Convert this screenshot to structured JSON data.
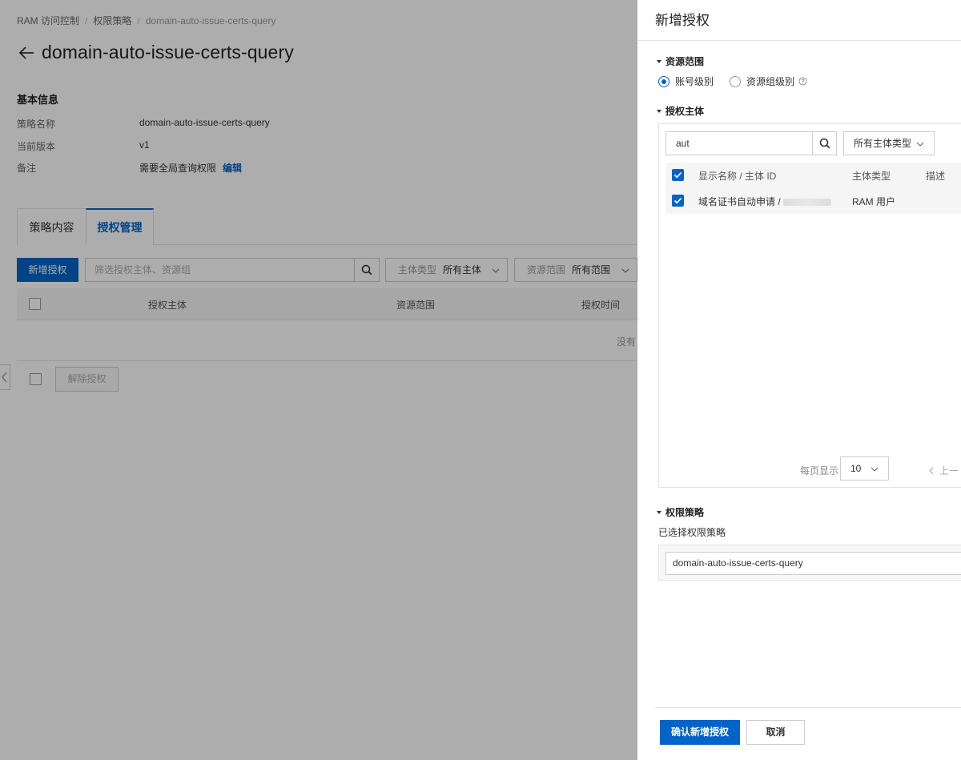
{
  "breadcrumb": {
    "items": [
      "RAM 访问控制",
      "权限策略",
      "domain-auto-issue-certs-query"
    ]
  },
  "page_title": "domain-auto-issue-certs-query",
  "basic_info": {
    "section_title": "基本信息",
    "rows": [
      {
        "label": "策略名称",
        "value": "domain-auto-issue-certs-query"
      },
      {
        "label": "当前版本",
        "value": "v1"
      },
      {
        "label": "备注",
        "value": "需要全局查询权限",
        "link": "编辑"
      }
    ]
  },
  "tabs": [
    {
      "label": "策略内容",
      "active": false
    },
    {
      "label": "授权管理",
      "active": true
    }
  ],
  "toolbar": {
    "add_button": "新增授权",
    "filter_placeholder": "筛选授权主体、资源组",
    "type_select": {
      "label": "主体类型",
      "value": "所有主体"
    },
    "range_select": {
      "label": "资源范围",
      "value": "所有范围"
    }
  },
  "table": {
    "columns": [
      "授权主体",
      "资源范围",
      "授权时间"
    ],
    "empty_text": "没有"
  },
  "footer": {
    "revoke_button": "解除授权"
  },
  "drawer": {
    "title": "新增授权",
    "resource_scope": {
      "title": "资源范围",
      "options": [
        {
          "label": "账号级别",
          "checked": true
        },
        {
          "label": "资源组级别",
          "checked": false
        }
      ]
    },
    "principal": {
      "title": "授权主体",
      "search_value": "aut",
      "type_select": "所有主体类型",
      "columns": [
        "显示名称 / 主体 ID",
        "主体类型",
        "描述"
      ],
      "rows": [
        {
          "name": "域名证书自动申请 /",
          "type": "RAM 用户",
          "desc": "",
          "checked": true
        }
      ],
      "pager": {
        "label": "每页显示",
        "page_size": "10",
        "prev": "上一"
      }
    },
    "policy": {
      "title": "权限策略",
      "selected_label": "已选择权限策略",
      "selected_value": "domain-auto-issue-certs-query"
    },
    "confirm_button": "确认新增授权",
    "cancel_button": "取消"
  },
  "colors": {
    "primary": "#0064c8",
    "overlay": "rgba(0,0,0,0.32)"
  }
}
